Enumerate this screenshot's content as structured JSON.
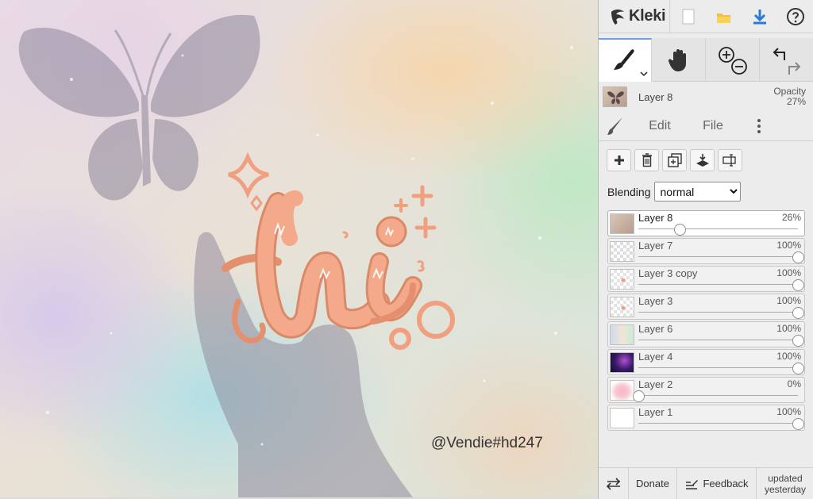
{
  "app": {
    "name": "Kleki"
  },
  "canvas": {
    "watermark": "@Vendie#hd247"
  },
  "current_layer": {
    "name": "Layer 8",
    "opacity_label": "Opacity",
    "opacity_value": "27%"
  },
  "tabs": {
    "edit": "Edit",
    "file": "File"
  },
  "blending": {
    "label": "Blending",
    "value": "normal"
  },
  "layers": [
    {
      "name": "Layer 8",
      "opacity": "26%",
      "fraction": 0.26,
      "selected": true,
      "thumb": "butterfly"
    },
    {
      "name": "Layer 7",
      "opacity": "100%",
      "fraction": 1.0,
      "selected": false,
      "thumb": "transparent"
    },
    {
      "name": "Layer 3 copy",
      "opacity": "100%",
      "fraction": 1.0,
      "selected": false,
      "thumb": "sketch"
    },
    {
      "name": "Layer 3",
      "opacity": "100%",
      "fraction": 1.0,
      "selected": false,
      "thumb": "sketch"
    },
    {
      "name": "Layer 6",
      "opacity": "100%",
      "fraction": 1.0,
      "selected": false,
      "thumb": "pastel"
    },
    {
      "name": "Layer 4",
      "opacity": "100%",
      "fraction": 1.0,
      "selected": false,
      "thumb": "galaxy"
    },
    {
      "name": "Layer 2",
      "opacity": "0%",
      "fraction": 0.0,
      "selected": false,
      "thumb": "pink"
    },
    {
      "name": "Layer 1",
      "opacity": "100%",
      "fraction": 1.0,
      "selected": false,
      "thumb": "white"
    }
  ],
  "bottombar": {
    "donate": "Donate",
    "feedback": "Feedback",
    "updated_line1": "updated",
    "updated_line2": "yesterday"
  },
  "colors": {
    "accent": "#6ea0e6",
    "art_peach": "#f0a080",
    "shadow": "#9b93a6",
    "download": "#2a78d8",
    "folder": "#f2c233"
  }
}
